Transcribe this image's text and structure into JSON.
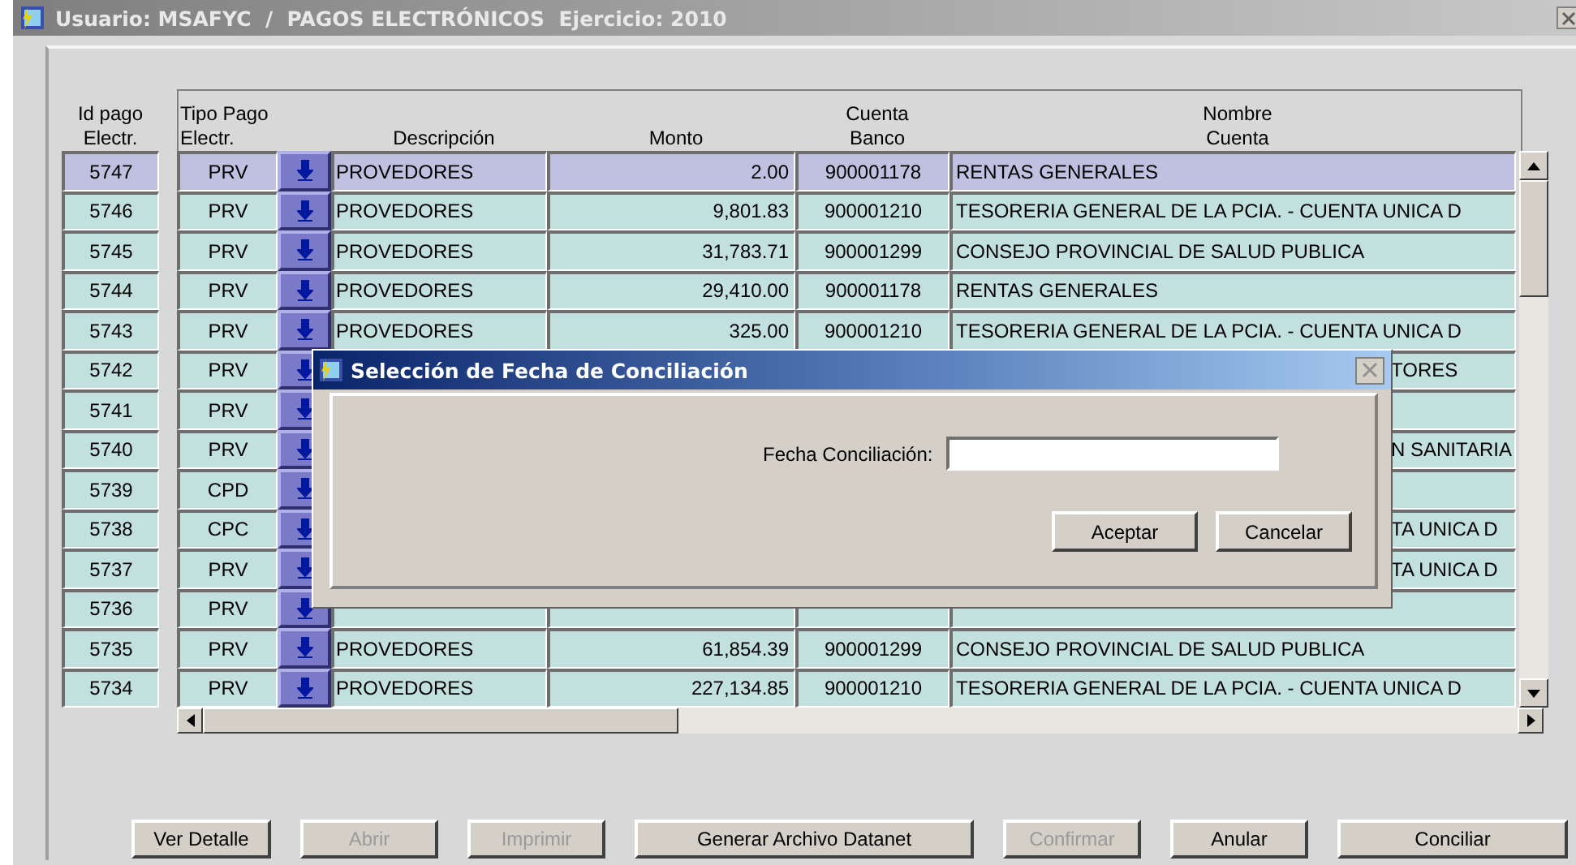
{
  "window": {
    "title": "Usuario: MSAFYC  /  PAGOS ELECTRÓNICOS  Ejercicio: 2010"
  },
  "table": {
    "columns": [
      {
        "lines": [
          "Id pago",
          "Electr."
        ]
      },
      {
        "lines": [
          "Tipo Pago",
          "Electr."
        ]
      },
      {
        "lines": [
          "Descripción"
        ]
      },
      {
        "lines": [
          "Monto"
        ]
      },
      {
        "lines": [
          "Cuenta",
          "Banco"
        ]
      },
      {
        "lines": [
          "Nombre",
          "Cuenta"
        ]
      }
    ],
    "rows": [
      {
        "id": "5747",
        "tipo": "PRV",
        "descripcion": "PROVEDORES",
        "monto": "2.00",
        "cuenta": "900001178",
        "nombre": "RENTAS GENERALES",
        "selected": true,
        "covered": false
      },
      {
        "id": "5746",
        "tipo": "PRV",
        "descripcion": "PROVEDORES",
        "monto": "9,801.83",
        "cuenta": "900001210",
        "nombre": "TESORERIA GENERAL DE LA PCIA. - CUENTA UNICA D",
        "selected": false,
        "covered": false
      },
      {
        "id": "5745",
        "tipo": "PRV",
        "descripcion": "PROVEDORES",
        "monto": "31,783.71",
        "cuenta": "900001299",
        "nombre": "CONSEJO PROVINCIAL DE SALUD PUBLICA",
        "selected": false,
        "covered": false
      },
      {
        "id": "5744",
        "tipo": "PRV",
        "descripcion": "PROVEDORES",
        "monto": "29,410.00",
        "cuenta": "900001178",
        "nombre": "RENTAS GENERALES",
        "selected": false,
        "covered": false
      },
      {
        "id": "5743",
        "tipo": "PRV",
        "descripcion": "PROVEDORES",
        "monto": "325.00",
        "cuenta": "900001210",
        "nombre": "TESORERIA GENERAL DE LA PCIA. - CUENTA UNICA D",
        "selected": false,
        "covered": false
      },
      {
        "id": "5742",
        "tipo": "PRV",
        "nombre": "TORES",
        "selected": false,
        "covered": true
      },
      {
        "id": "5741",
        "tipo": "PRV",
        "selected": false
      },
      {
        "id": "5740",
        "tipo": "PRV",
        "nombre": "N SANITARIA",
        "selected": false,
        "covered": true
      },
      {
        "id": "5739",
        "tipo": "CPD",
        "selected": false
      },
      {
        "id": "5738",
        "tipo": "CPC",
        "nombre": "TA UNICA D",
        "selected": false,
        "covered": true
      },
      {
        "id": "5737",
        "tipo": "PRV",
        "nombre": "TA UNICA D",
        "selected": false,
        "covered": true
      },
      {
        "id": "5736",
        "tipo": "PRV",
        "selected": false
      },
      {
        "id": "5735",
        "tipo": "PRV",
        "descripcion": "PROVEDORES",
        "monto": "61,854.39",
        "cuenta": "900001299",
        "nombre": "CONSEJO PROVINCIAL DE SALUD PUBLICA",
        "selected": false,
        "covered": false
      },
      {
        "id": "5734",
        "tipo": "PRV",
        "descripcion": "PROVEDORES",
        "monto": "227,134.85",
        "cuenta": "900001210",
        "nombre": "TESORERIA GENERAL DE LA PCIA. - CUENTA UNICA D",
        "selected": false,
        "covered": false
      }
    ]
  },
  "buttons": [
    {
      "label": "Ver Detalle",
      "disabled": false
    },
    {
      "label": "Abrir",
      "disabled": true
    },
    {
      "label": "Imprimir",
      "disabled": true
    },
    {
      "label": "Generar Archivo Datanet",
      "disabled": false
    },
    {
      "label": "Confirmar",
      "disabled": true
    },
    {
      "label": "Anular",
      "disabled": false
    },
    {
      "label": "Conciliar",
      "disabled": false
    }
  ],
  "dialog": {
    "title": "Selección de Fecha de Conciliación",
    "field_label": "Fecha Conciliación:",
    "buttons": [
      "Aceptar",
      "Cancelar"
    ]
  }
}
